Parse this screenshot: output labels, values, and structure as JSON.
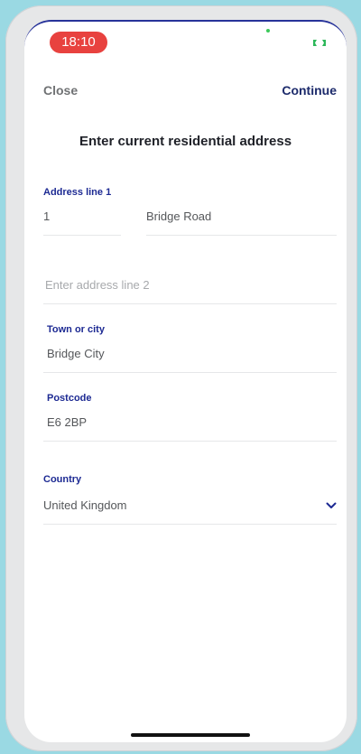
{
  "status_bar": {
    "time": "18:10",
    "time_pill_color": "#e8423f",
    "indicator_color": "#3cc95a"
  },
  "nav": {
    "close_label": "Close",
    "continue_label": "Continue"
  },
  "page": {
    "title": "Enter current residential address"
  },
  "form": {
    "address_line_1": {
      "label": "Address line 1",
      "house_number": "1",
      "street": "Bridge Road"
    },
    "address_line_2": {
      "placeholder": "Enter address line 2",
      "value": ""
    },
    "town": {
      "label": "Town or city",
      "value": "Bridge City"
    },
    "postcode": {
      "label": "Postcode",
      "value": "E6 2BP"
    },
    "country": {
      "label": "Country",
      "value": "United Kingdom",
      "icon": "chevron-down-icon"
    }
  },
  "colors": {
    "accent": "#1d2a93",
    "continue": "#1c2a6b",
    "background": "#9ad9e3"
  }
}
